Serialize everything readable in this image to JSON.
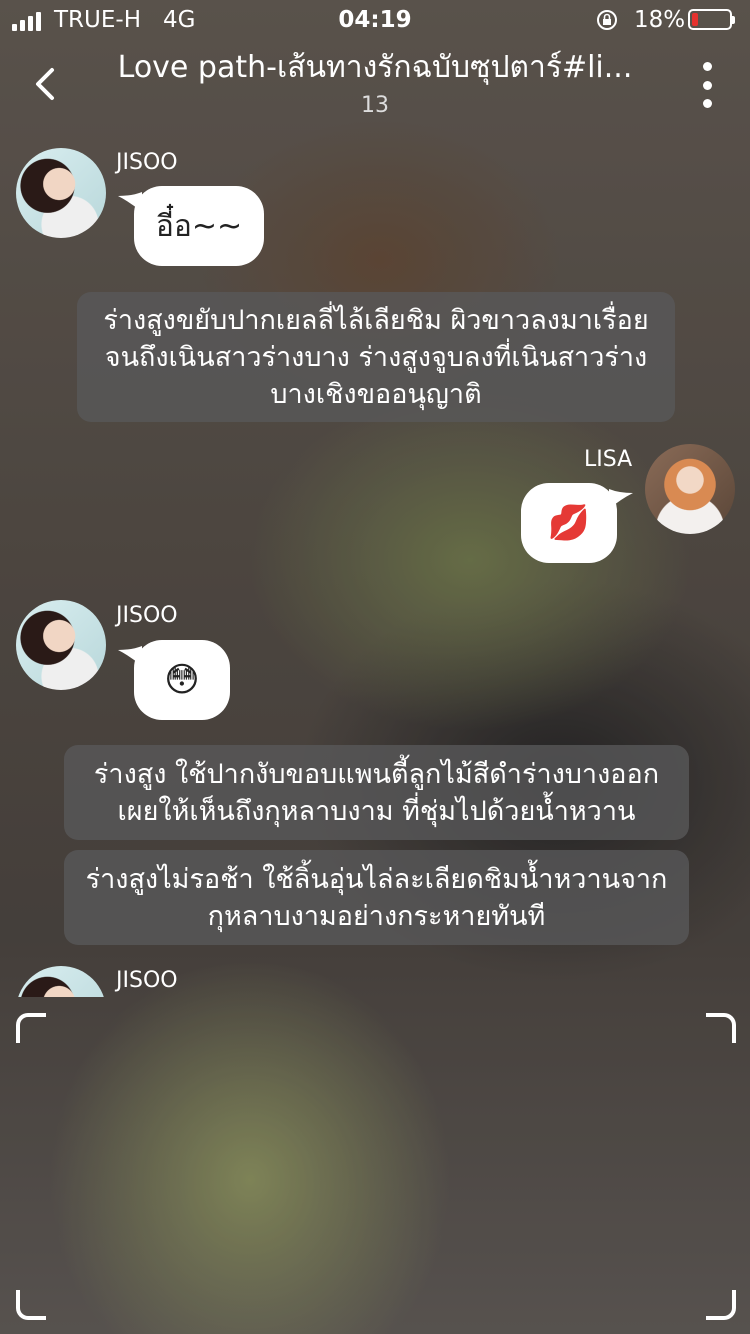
{
  "status": {
    "carrier": "TRUE-H",
    "network": "4G",
    "time": "04:19",
    "battery_percent": "18%",
    "battery_level": 0.18,
    "battery_color": "#e5322f"
  },
  "header": {
    "title": "Love path-เส้นทางรักฉบับซุปตาร์#li...",
    "count": "13",
    "back_icon": "chevron-left-icon",
    "menu_icon": "more-vertical-icon"
  },
  "messages": [
    {
      "sender": "JISOO",
      "side": "left",
      "text": "อี๋อ~~"
    },
    {
      "narration": "ร่างสูงขยับปากเยลลี่ไล้เลียชิม ผิวขาวลงมาเรื่อย จนถึงเนินสาวร่างบาง ร่างสูงจูบลงที่เนินสาวร่าง บางเชิงขออนุญาติ"
    },
    {
      "sender": "LISA",
      "side": "right",
      "text": "💋"
    },
    {
      "sender": "JISOO",
      "side": "left",
      "text": "😳"
    },
    {
      "narration": "ร่างสูง ใช้ปากงับขอบแพนตี้ลูกไม้สีดำร่างบางออก เผยให้เห็นถึงกุหลาบงาม ที่ชุ่มไปด้วยน้ำหวาน"
    },
    {
      "narration": "ร่างสูงไม่รอช้า ใช้ลิ้นอุ่นไล่ละเลียดชิมน้ำหวานจาก กุหลาบงามอย่างกระหายทันที"
    },
    {
      "sender": "JISOO",
      "side": "left",
      "text": ""
    }
  ]
}
